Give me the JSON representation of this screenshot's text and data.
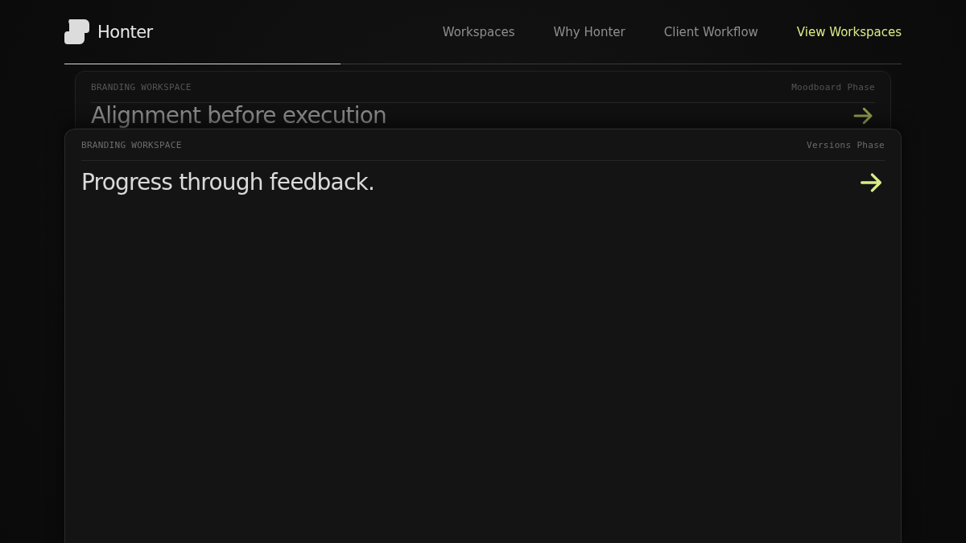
{
  "brand": {
    "name": "Honter"
  },
  "nav": [
    {
      "label": "Workspaces",
      "selected": false
    },
    {
      "label": "Why Honter",
      "selected": false
    },
    {
      "label": "Client Workflow",
      "selected": false
    },
    {
      "label": "View Workspaces",
      "selected": true
    }
  ],
  "progress": {
    "level": 0.33
  },
  "cards": [
    {
      "category": "BRANDING WORKSPACE",
      "phase": "Moodboard Phase",
      "title": "Alignment before execution"
    },
    {
      "category": "BRANDING WORKSPACE",
      "phase": "Versions Phase",
      "title": "Progress through feedback."
    }
  ]
}
